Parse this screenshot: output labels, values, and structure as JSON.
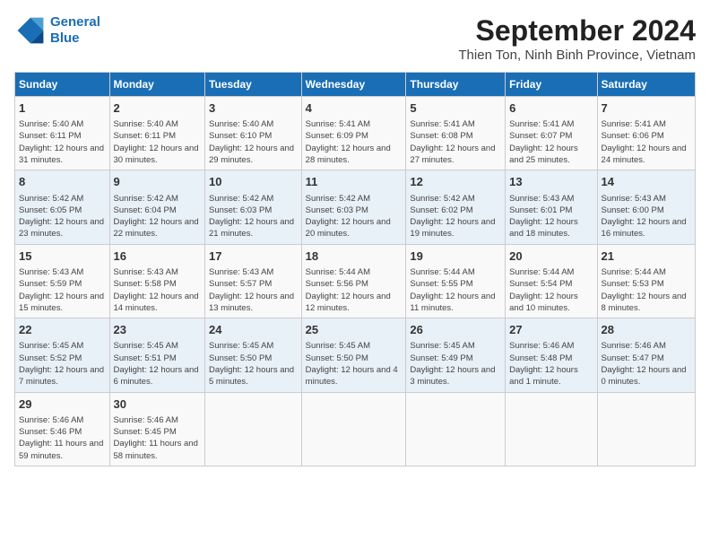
{
  "logo": {
    "line1": "General",
    "line2": "Blue"
  },
  "title": "September 2024",
  "subtitle": "Thien Ton, Ninh Binh Province, Vietnam",
  "days_of_week": [
    "Sunday",
    "Monday",
    "Tuesday",
    "Wednesday",
    "Thursday",
    "Friday",
    "Saturday"
  ],
  "weeks": [
    [
      {
        "day": "1",
        "sunrise": "Sunrise: 5:40 AM",
        "sunset": "Sunset: 6:11 PM",
        "daylight": "Daylight: 12 hours and 31 minutes."
      },
      {
        "day": "2",
        "sunrise": "Sunrise: 5:40 AM",
        "sunset": "Sunset: 6:11 PM",
        "daylight": "Daylight: 12 hours and 30 minutes."
      },
      {
        "day": "3",
        "sunrise": "Sunrise: 5:40 AM",
        "sunset": "Sunset: 6:10 PM",
        "daylight": "Daylight: 12 hours and 29 minutes."
      },
      {
        "day": "4",
        "sunrise": "Sunrise: 5:41 AM",
        "sunset": "Sunset: 6:09 PM",
        "daylight": "Daylight: 12 hours and 28 minutes."
      },
      {
        "day": "5",
        "sunrise": "Sunrise: 5:41 AM",
        "sunset": "Sunset: 6:08 PM",
        "daylight": "Daylight: 12 hours and 27 minutes."
      },
      {
        "day": "6",
        "sunrise": "Sunrise: 5:41 AM",
        "sunset": "Sunset: 6:07 PM",
        "daylight": "Daylight: 12 hours and 25 minutes."
      },
      {
        "day": "7",
        "sunrise": "Sunrise: 5:41 AM",
        "sunset": "Sunset: 6:06 PM",
        "daylight": "Daylight: 12 hours and 24 minutes."
      }
    ],
    [
      {
        "day": "8",
        "sunrise": "Sunrise: 5:42 AM",
        "sunset": "Sunset: 6:05 PM",
        "daylight": "Daylight: 12 hours and 23 minutes."
      },
      {
        "day": "9",
        "sunrise": "Sunrise: 5:42 AM",
        "sunset": "Sunset: 6:04 PM",
        "daylight": "Daylight: 12 hours and 22 minutes."
      },
      {
        "day": "10",
        "sunrise": "Sunrise: 5:42 AM",
        "sunset": "Sunset: 6:03 PM",
        "daylight": "Daylight: 12 hours and 21 minutes."
      },
      {
        "day": "11",
        "sunrise": "Sunrise: 5:42 AM",
        "sunset": "Sunset: 6:03 PM",
        "daylight": "Daylight: 12 hours and 20 minutes."
      },
      {
        "day": "12",
        "sunrise": "Sunrise: 5:42 AM",
        "sunset": "Sunset: 6:02 PM",
        "daylight": "Daylight: 12 hours and 19 minutes."
      },
      {
        "day": "13",
        "sunrise": "Sunrise: 5:43 AM",
        "sunset": "Sunset: 6:01 PM",
        "daylight": "Daylight: 12 hours and 18 minutes."
      },
      {
        "day": "14",
        "sunrise": "Sunrise: 5:43 AM",
        "sunset": "Sunset: 6:00 PM",
        "daylight": "Daylight: 12 hours and 16 minutes."
      }
    ],
    [
      {
        "day": "15",
        "sunrise": "Sunrise: 5:43 AM",
        "sunset": "Sunset: 5:59 PM",
        "daylight": "Daylight: 12 hours and 15 minutes."
      },
      {
        "day": "16",
        "sunrise": "Sunrise: 5:43 AM",
        "sunset": "Sunset: 5:58 PM",
        "daylight": "Daylight: 12 hours and 14 minutes."
      },
      {
        "day": "17",
        "sunrise": "Sunrise: 5:43 AM",
        "sunset": "Sunset: 5:57 PM",
        "daylight": "Daylight: 12 hours and 13 minutes."
      },
      {
        "day": "18",
        "sunrise": "Sunrise: 5:44 AM",
        "sunset": "Sunset: 5:56 PM",
        "daylight": "Daylight: 12 hours and 12 minutes."
      },
      {
        "day": "19",
        "sunrise": "Sunrise: 5:44 AM",
        "sunset": "Sunset: 5:55 PM",
        "daylight": "Daylight: 12 hours and 11 minutes."
      },
      {
        "day": "20",
        "sunrise": "Sunrise: 5:44 AM",
        "sunset": "Sunset: 5:54 PM",
        "daylight": "Daylight: 12 hours and 10 minutes."
      },
      {
        "day": "21",
        "sunrise": "Sunrise: 5:44 AM",
        "sunset": "Sunset: 5:53 PM",
        "daylight": "Daylight: 12 hours and 8 minutes."
      }
    ],
    [
      {
        "day": "22",
        "sunrise": "Sunrise: 5:45 AM",
        "sunset": "Sunset: 5:52 PM",
        "daylight": "Daylight: 12 hours and 7 minutes."
      },
      {
        "day": "23",
        "sunrise": "Sunrise: 5:45 AM",
        "sunset": "Sunset: 5:51 PM",
        "daylight": "Daylight: 12 hours and 6 minutes."
      },
      {
        "day": "24",
        "sunrise": "Sunrise: 5:45 AM",
        "sunset": "Sunset: 5:50 PM",
        "daylight": "Daylight: 12 hours and 5 minutes."
      },
      {
        "day": "25",
        "sunrise": "Sunrise: 5:45 AM",
        "sunset": "Sunset: 5:50 PM",
        "daylight": "Daylight: 12 hours and 4 minutes."
      },
      {
        "day": "26",
        "sunrise": "Sunrise: 5:45 AM",
        "sunset": "Sunset: 5:49 PM",
        "daylight": "Daylight: 12 hours and 3 minutes."
      },
      {
        "day": "27",
        "sunrise": "Sunrise: 5:46 AM",
        "sunset": "Sunset: 5:48 PM",
        "daylight": "Daylight: 12 hours and 1 minute."
      },
      {
        "day": "28",
        "sunrise": "Sunrise: 5:46 AM",
        "sunset": "Sunset: 5:47 PM",
        "daylight": "Daylight: 12 hours and 0 minutes."
      }
    ],
    [
      {
        "day": "29",
        "sunrise": "Sunrise: 5:46 AM",
        "sunset": "Sunset: 5:46 PM",
        "daylight": "Daylight: 11 hours and 59 minutes."
      },
      {
        "day": "30",
        "sunrise": "Sunrise: 5:46 AM",
        "sunset": "Sunset: 5:45 PM",
        "daylight": "Daylight: 11 hours and 58 minutes."
      },
      {
        "day": "",
        "sunrise": "",
        "sunset": "",
        "daylight": ""
      },
      {
        "day": "",
        "sunrise": "",
        "sunset": "",
        "daylight": ""
      },
      {
        "day": "",
        "sunrise": "",
        "sunset": "",
        "daylight": ""
      },
      {
        "day": "",
        "sunrise": "",
        "sunset": "",
        "daylight": ""
      },
      {
        "day": "",
        "sunrise": "",
        "sunset": "",
        "daylight": ""
      }
    ]
  ]
}
